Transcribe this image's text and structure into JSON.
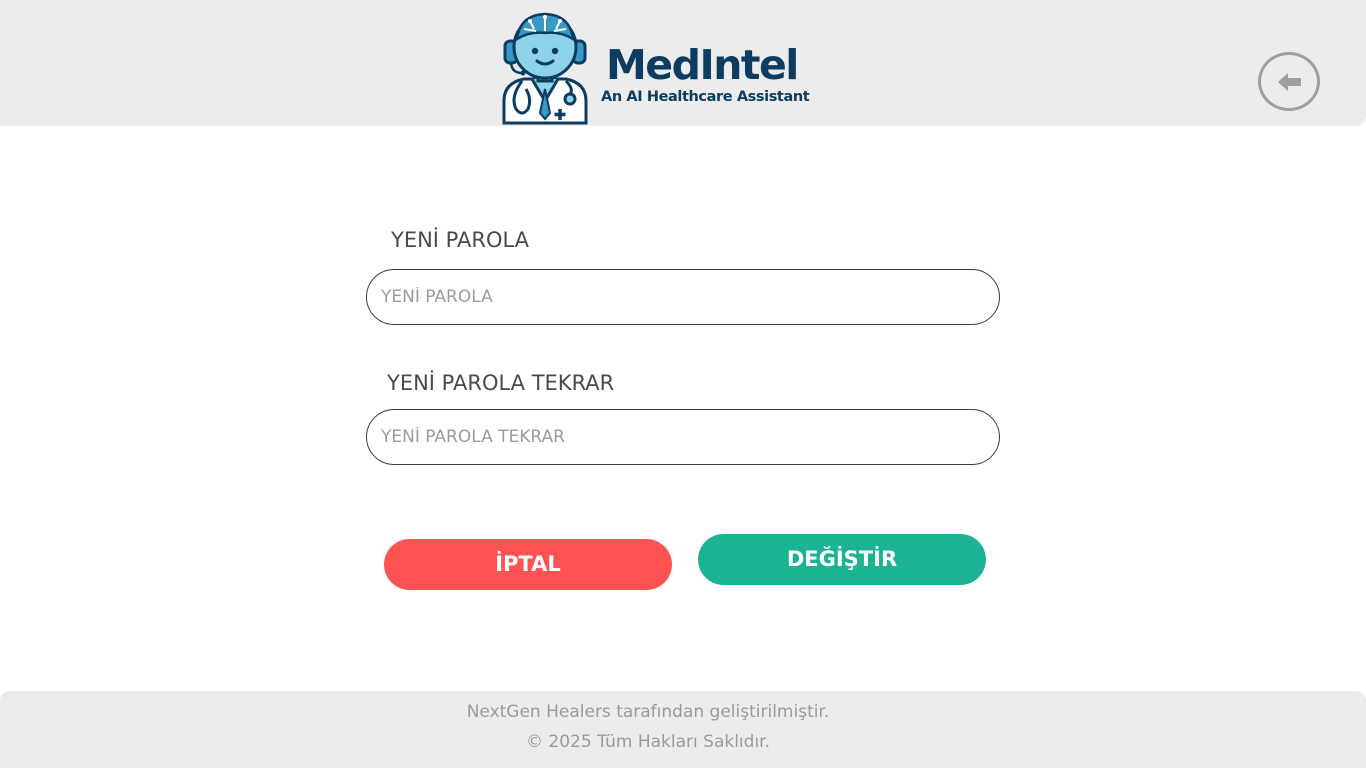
{
  "header": {
    "brand_name": "MedIntel",
    "brand_tagline": "An AI Healthcare Assistant",
    "logo_icon": "doctor-robot-mascot",
    "back_icon": "arrow-left-icon"
  },
  "form": {
    "new_password": {
      "label": "YENİ PAROLA",
      "placeholder": "YENİ PAROLA",
      "value": ""
    },
    "confirm_password": {
      "label": "YENİ PAROLA TEKRAR",
      "placeholder": "YENİ PAROLA TEKRAR",
      "value": ""
    },
    "cancel_label": "İPTAL",
    "submit_label": "DEĞİŞTİR"
  },
  "footer": {
    "line1": "NextGen Healers tarafından geliştirilmiştir.",
    "line2": "© 2025 Tüm Hakları Saklıdır."
  },
  "colors": {
    "brand": "#0d3c61",
    "cancel": "#ff5253",
    "submit": "#1bb394",
    "header_bg": "#ececec"
  }
}
